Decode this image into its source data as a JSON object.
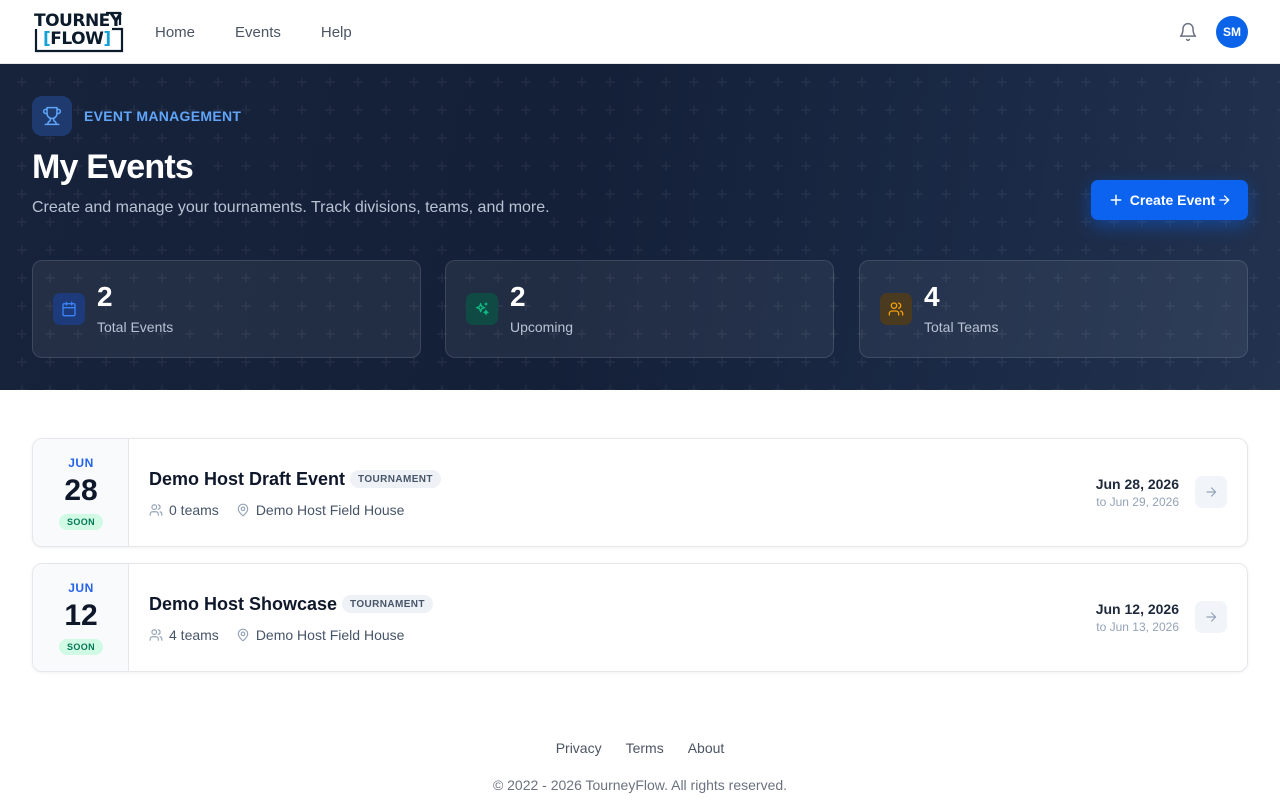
{
  "brand": {
    "line1": "TOURNEY",
    "line2_left": "[",
    "line2_text": "FLOW",
    "line2_right": "]"
  },
  "nav": {
    "links": [
      "Home",
      "Events",
      "Help"
    ]
  },
  "user": {
    "initials": "SM"
  },
  "hero": {
    "eyebrow": "EVENT MANAGEMENT",
    "title": "My Events",
    "subtitle": "Create and manage your tournaments. Track divisions, teams, and more.",
    "create_label": "Create Event"
  },
  "stats": [
    {
      "value": "2",
      "label": "Total Events",
      "icon": "calendar-icon",
      "color": "#3b82f6"
    },
    {
      "value": "2",
      "label": "Upcoming",
      "icon": "sparkle-icon",
      "color": "#10b981"
    },
    {
      "value": "4",
      "label": "Total Teams",
      "icon": "users-icon",
      "color": "#f59e0b"
    }
  ],
  "events": [
    {
      "month": "JUN",
      "day": "28",
      "status": "SOON",
      "title": "Demo Host Draft Event",
      "tag": "TOURNAMENT",
      "teams": "0 teams",
      "location": "Demo Host Field House",
      "start": "Jun 28, 2026",
      "end": "to Jun 29, 2026"
    },
    {
      "month": "JUN",
      "day": "12",
      "status": "SOON",
      "title": "Demo Host Showcase",
      "tag": "TOURNAMENT",
      "teams": "4 teams",
      "location": "Demo Host Field House",
      "start": "Jun 12, 2026",
      "end": "to Jun 13, 2026"
    }
  ],
  "footer": {
    "links": [
      "Privacy",
      "Terms",
      "About"
    ],
    "copyright": "© 2022 - 2026 TourneyFlow. All rights reserved."
  },
  "colors": {
    "accent": "#0b63f0",
    "hero_bg": "#17233b",
    "eyebrow": "#60a5fa",
    "soon_bg": "#d1fae5",
    "soon_text": "#047857"
  }
}
